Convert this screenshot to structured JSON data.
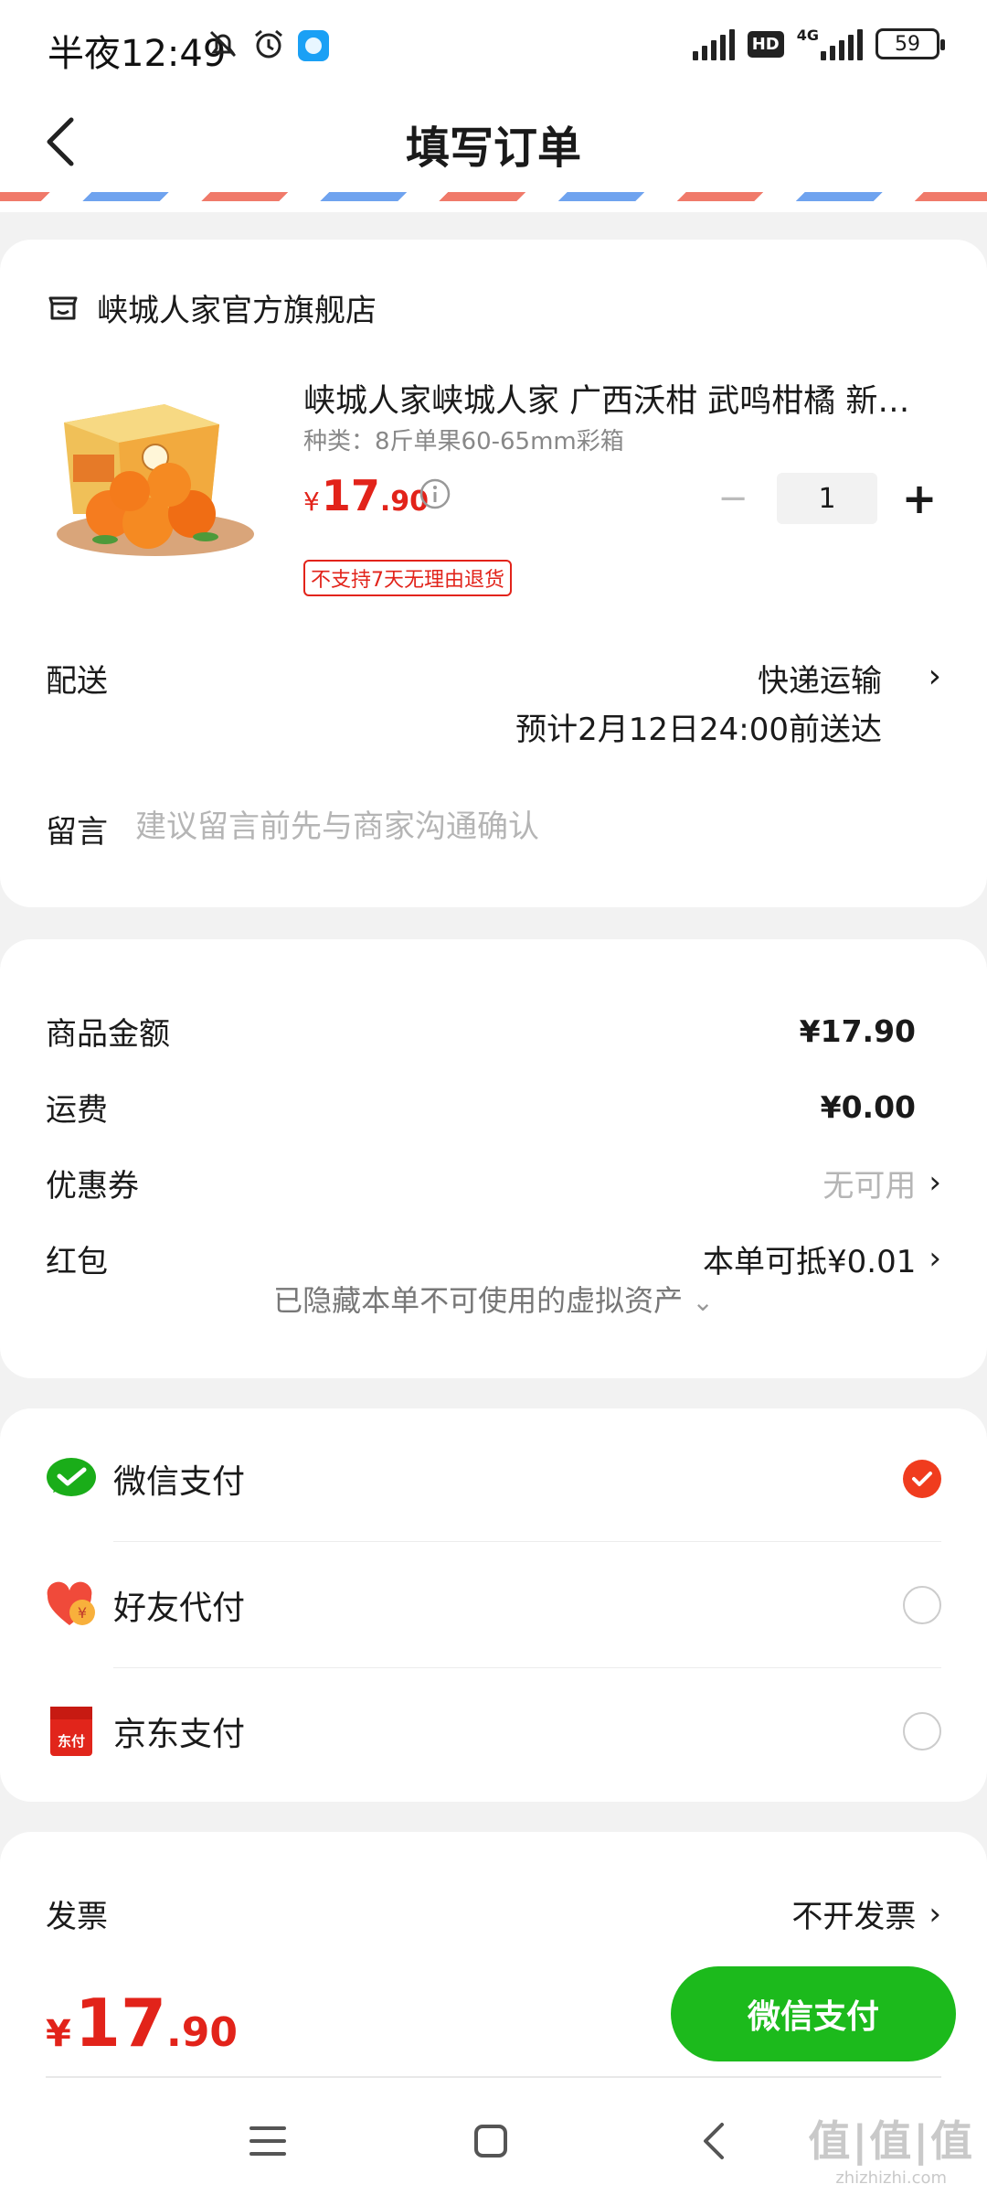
{
  "status_bar": {
    "time": "半夜12:49",
    "network": "4G",
    "hd": "HD",
    "battery": "59"
  },
  "header": {
    "title": "填写订单"
  },
  "store": {
    "name": "峡城人家官方旗舰店",
    "icon": "store-icon"
  },
  "product": {
    "title": "峡城人家峡城人家 广西沃柑 武鸣柑橘 新鲜水果",
    "spec": "种类：8斤单果60-65mm彩箱",
    "price_currency": "¥",
    "price_int": "17",
    "price_dec": ".90",
    "quantity": "1",
    "minus": "−",
    "plus": "+",
    "return_policy": "不支持7天无理由退货"
  },
  "delivery": {
    "label": "配送",
    "method": "快递运输",
    "eta": "预计2月12日24:00前送达"
  },
  "message": {
    "label": "留言",
    "placeholder": "建议留言前先与商家沟通确认"
  },
  "amounts": {
    "goods_label": "商品金额",
    "goods_value": "¥17.90",
    "shipping_label": "运费",
    "shipping_value": "¥0.00",
    "coupon_label": "优惠券",
    "coupon_value": "无可用",
    "redpacket_label": "红包",
    "redpacket_value": "本单可抵¥0.01",
    "hidden_assets": "已隐藏本单不可使用的虚拟资产"
  },
  "payment": {
    "methods": [
      {
        "label": "微信支付",
        "icon": "wechat-pay-icon",
        "selected": true
      },
      {
        "label": "好友代付",
        "icon": "friend-pay-icon",
        "selected": false
      },
      {
        "label": "京东支付",
        "icon": "jd-pay-icon",
        "selected": false,
        "icon_text": "东付"
      }
    ]
  },
  "invoice": {
    "label": "发票",
    "value": "不开发票"
  },
  "footer": {
    "total_currency": "¥",
    "total_int": "17",
    "total_dec": ".90",
    "pay_button": "微信支付"
  },
  "watermark": {
    "main": "值|值|值",
    "sub": "zhizhizhi.com"
  },
  "colors": {
    "accent_red": "#e2231a",
    "wechat_green": "#1cba1c",
    "radio_selected": "#f03c1e"
  }
}
